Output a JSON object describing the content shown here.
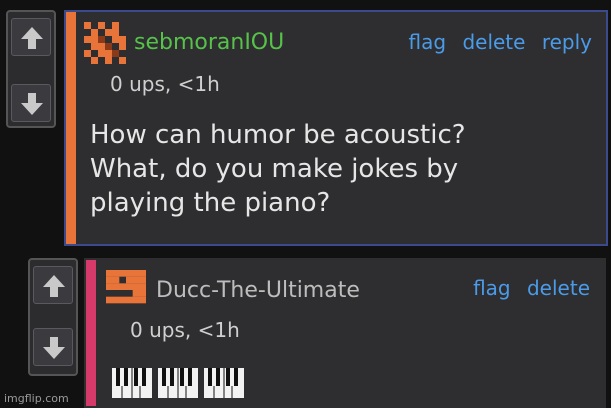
{
  "comments": [
    {
      "username": "sebmoranIOU",
      "meta": "0 ups, <1h",
      "actions": [
        "flag",
        "delete",
        "reply"
      ],
      "body_lines": [
        "How can humor be acoustic?",
        "What, do you make jokes by",
        "playing the piano?"
      ],
      "colors": {
        "username": "#56c24a",
        "bar": "#e8743a"
      }
    },
    {
      "username": "Ducc-The-Ultimate",
      "meta": "0 ups, <1h",
      "actions": [
        "flag",
        "delete"
      ],
      "body_icons": [
        "piano-keys-icon",
        "piano-keys-icon",
        "piano-keys-icon"
      ],
      "colors": {
        "username": "#bdbdbd",
        "bar": "#d63a6a"
      }
    }
  ],
  "watermark": "imgflip.com"
}
